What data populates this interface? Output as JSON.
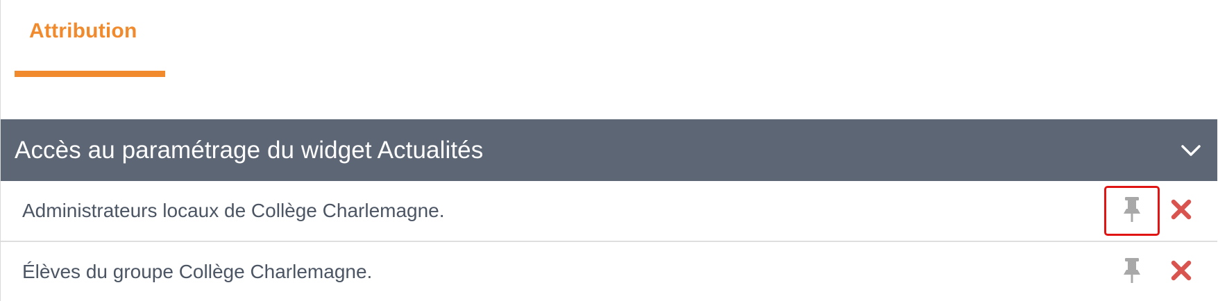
{
  "tabs": [
    {
      "label": "Attribution",
      "active": true
    }
  ],
  "section": {
    "title": "Accès au paramétrage du widget Actualités",
    "collapse_icon": "chevron-down-icon"
  },
  "rows": [
    {
      "label": "Administrateurs locaux de Collège Charlemagne.",
      "pin_icon": "pin-icon",
      "delete_icon": "close-icon",
      "pin_highlighted": true
    },
    {
      "label": "Élèves du groupe Collège Charlemagne.",
      "pin_icon": "pin-icon",
      "delete_icon": "close-icon",
      "pin_highlighted": false
    }
  ],
  "colors": {
    "accent": "#f18a2c",
    "header_bg": "#5d6675",
    "delete": "#d9534f",
    "pin": "#a8a8a8",
    "highlight": "#e11414"
  }
}
